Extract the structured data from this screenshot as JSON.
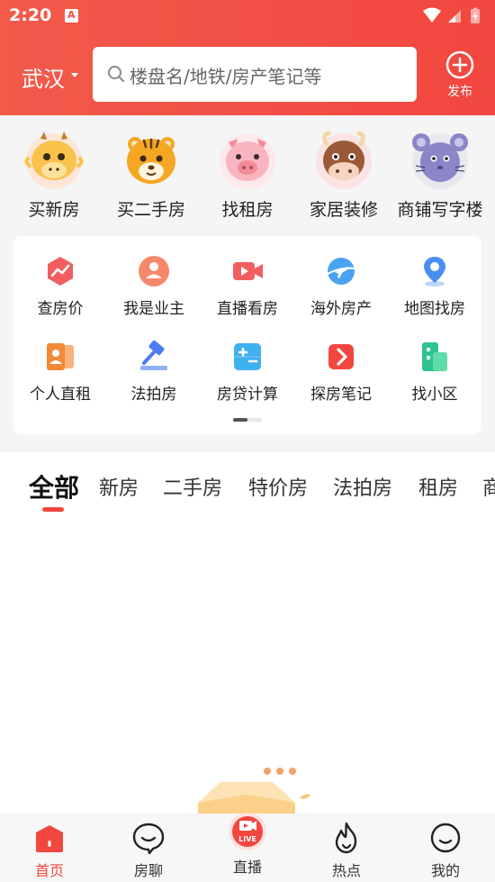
{
  "status_bar": {
    "time": "2:20"
  },
  "header": {
    "city": "武汉",
    "search_placeholder": "楼盘名/地铁/房产笔记等",
    "publish_label": "发布",
    "colors": {
      "brand": "#f2473f"
    }
  },
  "categories": [
    {
      "label": "买新房",
      "icon": "dragon-avatar-icon"
    },
    {
      "label": "买二手房",
      "icon": "tiger-avatar-icon"
    },
    {
      "label": "找租房",
      "icon": "pig-avatar-icon"
    },
    {
      "label": "家居装修",
      "icon": "ox-avatar-icon"
    },
    {
      "label": "商铺写字楼",
      "icon": "mouse-avatar-icon"
    }
  ],
  "grid": [
    {
      "label": "查房价",
      "icon": "price-trend-icon"
    },
    {
      "label": "我是业主",
      "icon": "owner-icon"
    },
    {
      "label": "直播看房",
      "icon": "live-video-icon"
    },
    {
      "label": "海外房产",
      "icon": "plane-globe-icon"
    },
    {
      "label": "地图找房",
      "icon": "map-pin-icon"
    },
    {
      "label": "个人直租",
      "icon": "personal-rent-icon"
    },
    {
      "label": "法拍房",
      "icon": "auction-gavel-icon"
    },
    {
      "label": "房贷计算",
      "icon": "calculator-icon"
    },
    {
      "label": "探房笔记",
      "icon": "notes-arrow-icon"
    },
    {
      "label": "找小区",
      "icon": "community-building-icon"
    }
  ],
  "tabs": [
    "全部",
    "新房",
    "二手房",
    "特价房",
    "法拍房",
    "租房",
    "商"
  ],
  "bottom_nav": [
    {
      "label": "首页",
      "icon": "home-icon"
    },
    {
      "label": "房聊",
      "icon": "chat-icon"
    },
    {
      "label": "直播",
      "icon": "live-icon",
      "badge": "LIVE"
    },
    {
      "label": "热点",
      "icon": "flame-icon"
    },
    {
      "label": "我的",
      "icon": "profile-icon"
    }
  ]
}
